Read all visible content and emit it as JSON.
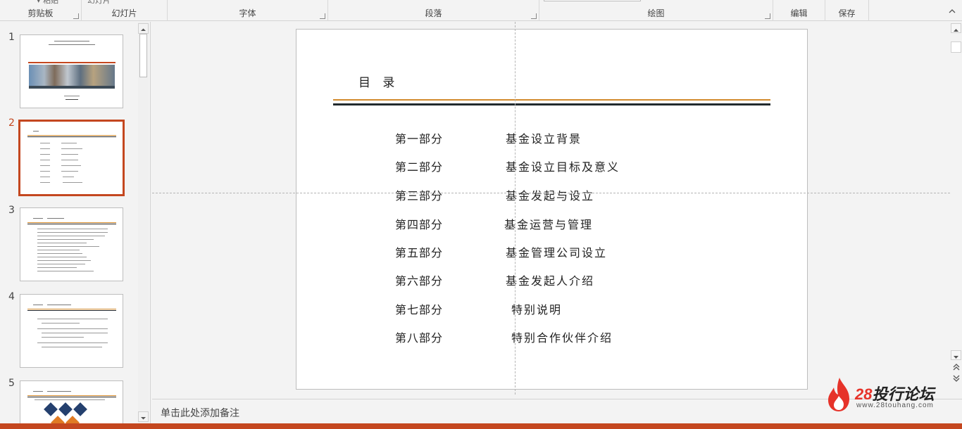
{
  "ribbon": {
    "groups": [
      {
        "label": "剪贴板"
      },
      {
        "label": "幻灯片"
      },
      {
        "label": "字体"
      },
      {
        "label": "段落"
      },
      {
        "label": "绘图"
      },
      {
        "label": "编辑"
      },
      {
        "label": "保存"
      }
    ],
    "partial_new_slide": "幻灯片"
  },
  "thumbnails": [
    {
      "number": "1"
    },
    {
      "number": "2"
    },
    {
      "number": "3"
    },
    {
      "number": "4"
    },
    {
      "number": "5"
    }
  ],
  "slide": {
    "title": "目 录",
    "toc": [
      {
        "part": "第一部分",
        "name": "基金设立背景"
      },
      {
        "part": "第二部分",
        "name": "基金设立目标及意义"
      },
      {
        "part": "第三部分",
        "name": "基金发起与设立"
      },
      {
        "part": "第四部分",
        "name": "基金运营与管理"
      },
      {
        "part": "第五部分",
        "name": "基金管理公司设立"
      },
      {
        "part": "第六部分",
        "name": "基金发起人介绍"
      },
      {
        "part": "第七部分",
        "name": "特别说明"
      },
      {
        "part": "第八部分",
        "name": "特别合作伙伴介绍"
      }
    ]
  },
  "notes": {
    "placeholder": "单击此处添加备注"
  },
  "watermark": {
    "brand_num": "28",
    "brand_text": "投行论坛",
    "url": "www.28touhang.com"
  },
  "colors": {
    "accent": "#c4471f",
    "rule_orange": "#d28a2c",
    "rule_dark": "#222a2e"
  }
}
